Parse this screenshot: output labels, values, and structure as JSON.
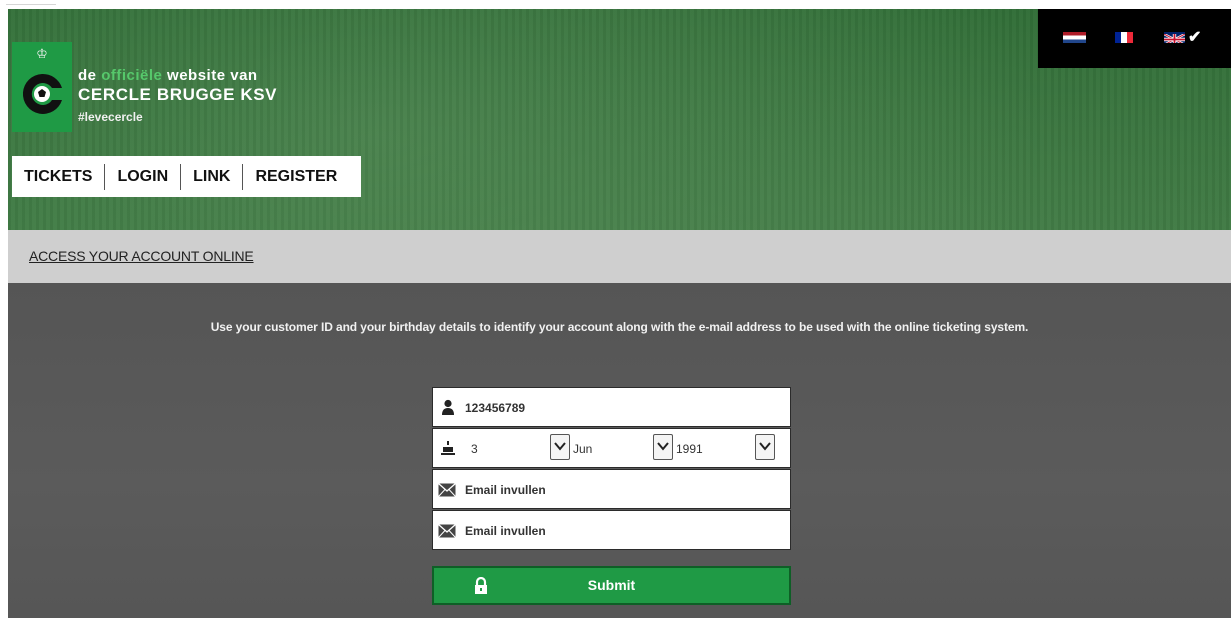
{
  "header": {
    "tagline_prefix": "de",
    "tagline_highlight": "officiële",
    "tagline_suffix": "website van",
    "club_name": "CERCLE BRUGGE KSV",
    "hashtag": "#levecercle"
  },
  "languages": [
    {
      "code": "nl",
      "icon": "netherlands-flag-icon"
    },
    {
      "code": "fr",
      "icon": "france-flag-icon"
    },
    {
      "code": "en",
      "icon": "uk-flag-icon",
      "selected": true
    }
  ],
  "nav": {
    "items": [
      "TICKETS",
      "LOGIN",
      "LINK",
      "REGISTER"
    ]
  },
  "section": {
    "title": "ACCESS YOUR ACCOUNT ONLINE",
    "intro": "Use your customer ID and your birthday details to identify your account along with the e-mail address to be used with the online ticketing system."
  },
  "form": {
    "customer_id": "123456789",
    "dob_day": "3",
    "dob_month": "Jun",
    "dob_year": "1991",
    "email_placeholder": "Email invullen",
    "email_confirm_placeholder": "Email invullen",
    "submit_label": "Submit"
  },
  "colors": {
    "brand_green": "#1f9a45",
    "highlight_green": "#56c86b",
    "panel_gray": "#585858",
    "header_gray": "#cfcfcf"
  }
}
